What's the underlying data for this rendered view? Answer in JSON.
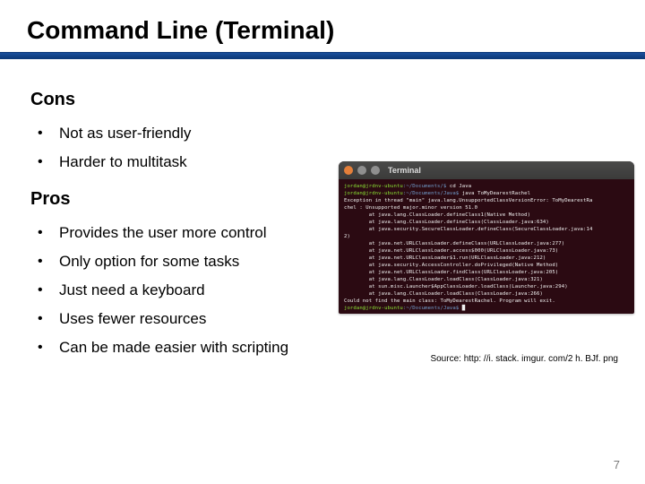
{
  "title": "Command Line (Terminal)",
  "sections": {
    "cons": {
      "heading": "Cons",
      "items": [
        "Not as user-friendly",
        "Harder to multitask"
      ]
    },
    "pros": {
      "heading": "Pros",
      "items": [
        "Provides the user more control",
        "Only option for some tasks",
        "Just need a keyboard",
        "Uses fewer resources",
        "Can be made easier with scripting"
      ]
    }
  },
  "terminal": {
    "window_title": "Terminal",
    "lines": [
      {
        "prompt": "jordan@jrdnv-ubuntu",
        "path": ":~/Documents/$",
        "cmd": " cd Java"
      },
      {
        "prompt": "jordan@jrdnv-ubuntu",
        "path": ":~/Documents/Java$",
        "cmd": " java ToMyDearestRachel"
      },
      {
        "plain": "Exception in thread \"main\" java.lang.UnsupportedClassVersionError: ToMyDearestRa"
      },
      {
        "plain": "chel : Unsupported major.minor version 51.0"
      },
      {
        "plain": "        at java.lang.ClassLoader.defineClass1(Native Method)"
      },
      {
        "plain": "        at java.lang.ClassLoader.defineClass(ClassLoader.java:634)"
      },
      {
        "plain": "        at java.security.SecureClassLoader.defineClass(SecureClassLoader.java:14"
      },
      {
        "plain": "2)"
      },
      {
        "plain": "        at java.net.URLClassLoader.defineClass(URLClassLoader.java:277)"
      },
      {
        "plain": "        at java.net.URLClassLoader.access$000(URLClassLoader.java:73)"
      },
      {
        "plain": "        at java.net.URLClassLoader$1.run(URLClassLoader.java:212)"
      },
      {
        "plain": "        at java.security.AccessController.doPrivileged(Native Method)"
      },
      {
        "plain": "        at java.net.URLClassLoader.findClass(URLClassLoader.java:205)"
      },
      {
        "plain": "        at java.lang.ClassLoader.loadClass(ClassLoader.java:321)"
      },
      {
        "plain": "        at sun.misc.Launcher$AppClassLoader.loadClass(Launcher.java:294)"
      },
      {
        "plain": "        at java.lang.ClassLoader.loadClass(ClassLoader.java:266)"
      },
      {
        "plain": "Could not find the main class: ToMyDearestRachel. Program will exit."
      },
      {
        "prompt": "jordan@jrdnv-ubuntu",
        "path": ":~/Documents/Java$",
        "cmd": " █"
      }
    ]
  },
  "caption": "Source: http: //i. stack. imgur. com/2 h. BJf. png",
  "page_number": "7"
}
